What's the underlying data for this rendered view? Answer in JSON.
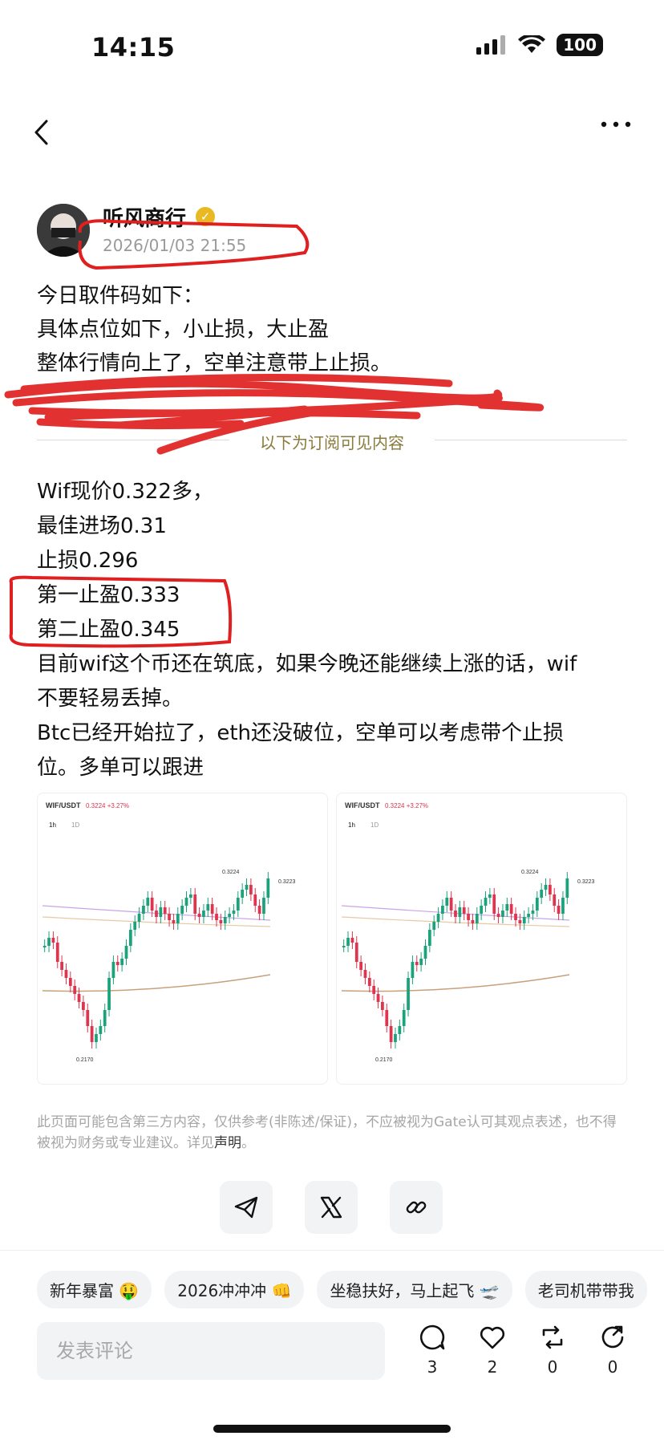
{
  "status": {
    "time": "14:15",
    "battery": "100"
  },
  "author": {
    "name": "听风商行",
    "timestamp": "2026/01/03 21:55"
  },
  "post": {
    "lines_top": [
      "今日取件码如下：",
      "具体点位如下，小止损，大止盈",
      "整体行情向上了，空单注意带上止损。"
    ],
    "subscribe_label": "以下为订阅可见内容",
    "lines_bottom": [
      "Wif现价0.322多，",
      "最佳进场0.31",
      "止损0.296",
      "第一止盈0.333",
      "第二止盈0.345",
      "目前wif这个币还在筑底，如果今晚还能继续上涨的话，wif",
      "不要轻易丢掉。",
      "Btc已经开始拉了，eth还没破位，空单可以考虑带个止损",
      "位。多单可以跟进"
    ]
  },
  "charts": [
    {
      "pair": "WIF/USDT",
      "price": "0.3224",
      "change": "+3.27%",
      "tabs": [
        "1h",
        "1D"
      ],
      "high_label": "0.3224",
      "last_label": "0.3223",
      "low_label": "0.2170"
    },
    {
      "pair": "WIF/USDT",
      "price": "0.3224",
      "change": "+3.27%",
      "tabs": [
        "1h",
        "1D"
      ],
      "high_label": "0.3224",
      "last_label": "0.3223",
      "low_label": "0.2170"
    }
  ],
  "disclaimer": {
    "text": "此页面可能包含第三方内容，仅供参考(非陈述/保证)，不应被视为Gate认可其观点表述，也不得被视为财务或专业建议。详见",
    "link": "声明",
    "tail": "。"
  },
  "tags": [
    "新年暴富 🤑",
    "2026冲冲冲 👊",
    "坐稳扶好，马上起飞 🛫",
    "老司机带带我"
  ],
  "comment_placeholder": "发表评论",
  "actions": {
    "comments": "3",
    "likes": "2",
    "reposts": "0",
    "shares": "0"
  },
  "icons": [
    "back-icon",
    "more-icon",
    "verified-icon",
    "telegram-icon",
    "x-icon",
    "link-icon",
    "comment-icon",
    "like-icon",
    "repost-icon",
    "share-icon"
  ],
  "colors": {
    "verified": "#e8b923",
    "subscribe_label": "#8a7a3c",
    "annotation_red": "#e02020",
    "candle_green": "#1aa37a",
    "candle_red": "#e0334d"
  }
}
